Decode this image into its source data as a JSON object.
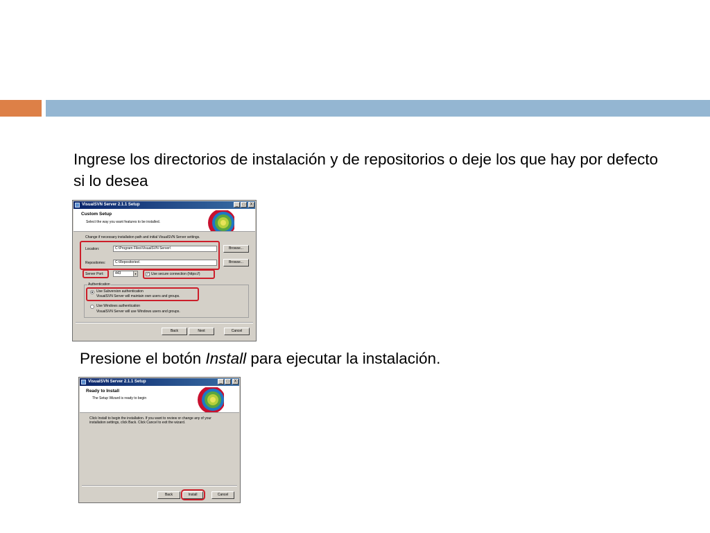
{
  "slide": {
    "text1": "Ingrese los directorios de instalación y de repositorios o deje los que hay por defecto si lo desea",
    "text2_before": "Presione el botón ",
    "text2_italic": "Install",
    "text2_after": " para ejecutar la instalación."
  },
  "dialog1": {
    "title": "VisualSVN Server 2.1.1 Setup",
    "min": "_",
    "max": "□",
    "close": "X",
    "header_title": "Custom Setup",
    "header_subtitle": "Select the way you want features to be installed.",
    "instructions": "Change if necessary installation path and initial VisualSVN Server settings.",
    "location_label": "Location:",
    "location_value": "C:\\Program Files\\VisualSVN Server\\",
    "repositories_label": "Repositories:",
    "repositories_value": "C:\\Repositories\\",
    "browse_label": "Browse...",
    "server_port_label": "Server Port:",
    "server_port_value": "443",
    "secure_connection_label": "Use secure connection (https://)",
    "secure_checked_mark": "✓",
    "auth_group_label": "Authentication",
    "svn_auth_label": "Use Subversion authentication",
    "svn_auth_desc": "VisualSVN Server will maintain own users and groups.",
    "win_auth_label": "Use Windows authentication",
    "win_auth_desc": "VisualSVN Server will use Windows users and groups.",
    "back_label": "Back",
    "next_label": "Next",
    "cancel_label": "Cancel"
  },
  "dialog2": {
    "title": "VisualSVN Server 2.1.1 Setup",
    "min": "_",
    "max": "□",
    "close": "X",
    "header_title": "Ready to Install",
    "header_subtitle": "The Setup Wizard is ready to begin",
    "body_line1": "Click Install to begin the installation. If you want to review or change any of your",
    "body_line2": "installation settings, click Back. Click Cancel to exit the wizard.",
    "back_label": "Back",
    "install_label": "Install",
    "cancel_label": "Cancel"
  },
  "colors": {
    "accent_orange": "#dd8047",
    "accent_blue": "#94b6d2",
    "highlight_red": "#cc1e2a"
  },
  "icons": [
    "visualsvn-logo-icon",
    "app-icon"
  ]
}
